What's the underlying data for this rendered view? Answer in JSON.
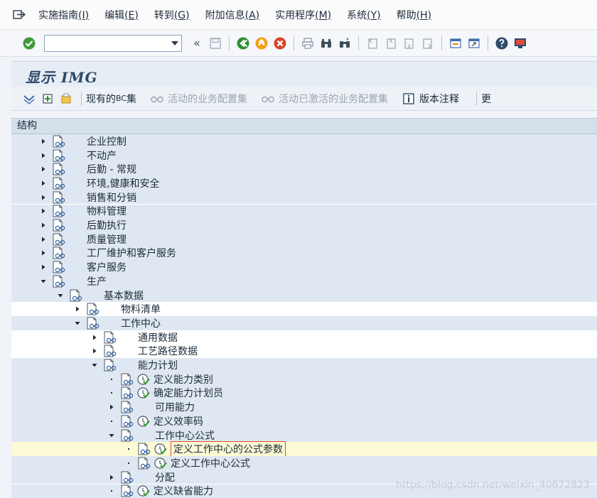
{
  "menubar": {
    "items": [
      {
        "label": "实施指南",
        "key": "(I)"
      },
      {
        "label": "编辑",
        "key": "(E)"
      },
      {
        "label": "转到",
        "key": "(G)"
      },
      {
        "label": "附加信息",
        "key": "(A)"
      },
      {
        "label": "实用程序",
        "key": "(M)"
      },
      {
        "label": "系统",
        "key": "(Y)"
      },
      {
        "label": "帮助",
        "key": "(H)"
      }
    ]
  },
  "stdbar": {
    "command_value": "",
    "back_glyph": "«"
  },
  "title": {
    "text": "显示 IMG"
  },
  "appbar": {
    "current_bc_set_prefix": "现有的 ",
    "current_bc_set_bc": "BC",
    "current_bc_set_suffix": " 集",
    "active_bc_set": "活动的业务配置集",
    "activated_bc_set": "活动已激活的业务配置集",
    "release_notes": "版本注释",
    "more": "更"
  },
  "tree": {
    "header": "结构",
    "rows": [
      {
        "label": "企业控制",
        "level": 0,
        "state": "collapsed",
        "activity": false
      },
      {
        "label": "不动产",
        "level": 0,
        "state": "collapsed",
        "activity": false
      },
      {
        "label": "后勤 - 常规",
        "level": 0,
        "state": "collapsed",
        "activity": false
      },
      {
        "label": "环境,健康和安全",
        "level": 0,
        "state": "collapsed",
        "activity": false
      },
      {
        "label": "销售和分销",
        "level": 0,
        "state": "collapsed",
        "activity": false
      },
      {
        "label": "物料管理",
        "level": 0,
        "state": "collapsed",
        "activity": false
      },
      {
        "label": "后勤执行",
        "level": 0,
        "state": "collapsed",
        "activity": false
      },
      {
        "label": "质量管理",
        "level": 0,
        "state": "collapsed",
        "activity": false
      },
      {
        "label": "工厂维护和客户服务",
        "level": 0,
        "state": "collapsed",
        "activity": false
      },
      {
        "label": "客户服务",
        "level": 0,
        "state": "collapsed",
        "activity": false
      },
      {
        "label": "生产",
        "level": 0,
        "state": "expanded",
        "activity": false
      },
      {
        "label": "基本数据",
        "level": 1,
        "state": "expanded",
        "activity": false
      },
      {
        "label": "物料清单",
        "level": 2,
        "state": "collapsed",
        "activity": false
      },
      {
        "label": "工作中心",
        "level": 2,
        "state": "expanded",
        "activity": false
      },
      {
        "label": "通用数据",
        "level": 3,
        "state": "collapsed",
        "activity": false
      },
      {
        "label": "工艺路径数据",
        "level": 3,
        "state": "collapsed",
        "activity": false
      },
      {
        "label": "能力计划",
        "level": 3,
        "state": "expanded",
        "activity": false
      },
      {
        "label": "定义能力类别",
        "level": 4,
        "state": "leaf",
        "activity": true
      },
      {
        "label": "确定能力计划员",
        "level": 4,
        "state": "leaf",
        "activity": true
      },
      {
        "label": "可用能力",
        "level": 4,
        "state": "collapsed",
        "activity": false
      },
      {
        "label": "定义效率码",
        "level": 4,
        "state": "leaf",
        "activity": true
      },
      {
        "label": "工作中心公式",
        "level": 4,
        "state": "expanded",
        "activity": false
      },
      {
        "label": "定义工作中心的公式参数",
        "level": 5,
        "state": "leaf",
        "activity": true,
        "selected": true
      },
      {
        "label": "定义工作中心公式",
        "level": 5,
        "state": "leaf",
        "activity": true
      },
      {
        "label": "分配",
        "level": 4,
        "state": "collapsed",
        "activity": false
      },
      {
        "label": "定义缺省能力",
        "level": 4,
        "state": "leaf",
        "activity": true
      }
    ]
  },
  "watermark": "https://blog.csdn.net/weixin_40672823"
}
